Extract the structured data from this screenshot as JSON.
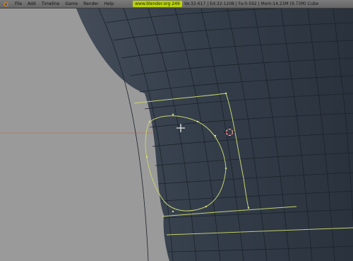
{
  "header": {
    "menu": [
      "File",
      "Add",
      "Timeline",
      "Game",
      "Render",
      "Help"
    ],
    "url_badge": "www.blender.org 249",
    "stats": "Ve:32-617 | Ed:32-1208 | Fa:0-592 | Mem:14.23M (9.73M) Cube"
  },
  "colors": {
    "header_bg": "#6f6f6f",
    "url_badge_bg": "#b9d400",
    "viewport_bg": "#9a9a9a",
    "mesh_fill": "#36404b",
    "mesh_wire": "#1b222b",
    "selection_edge": "#c8d470",
    "axis_line": "#b07060"
  },
  "icons": [
    "blender-logo-icon",
    "3d-cursor-icon",
    "mouse-cursor-crosshair-icon"
  ]
}
